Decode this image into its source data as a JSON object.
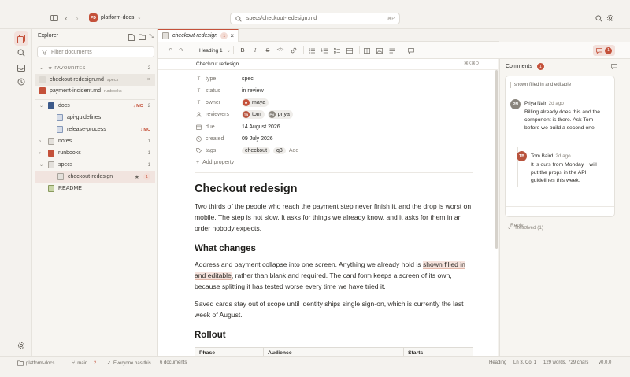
{
  "titlebar": {
    "workspace_initials": "PD",
    "workspace_name": "platform-docs",
    "search_text": "specs/checkout-redesign.md",
    "search_shortcut": "⌘P"
  },
  "sidebar": {
    "title": "Explorer",
    "filter_placeholder": "Filter documents",
    "favourites_label": "FAVOURITES",
    "favourites_count": "2",
    "favourites": [
      {
        "name": "checkout-redesign.md",
        "folder": "specs"
      },
      {
        "name": "payment-incident.md",
        "folder": "runbooks"
      }
    ],
    "tree": {
      "docs": {
        "label": "docs",
        "count": "2",
        "mc": "↓ MC"
      },
      "api_guidelines": {
        "label": "api-guidelines"
      },
      "release_process": {
        "label": "release-process",
        "mc": "↓ MC"
      },
      "notes": {
        "label": "notes",
        "count": "1"
      },
      "runbooks": {
        "label": "runbooks",
        "count": "1"
      },
      "specs": {
        "label": "specs",
        "count": "1"
      },
      "checkout_redesign": {
        "label": "checkout-redesign",
        "badge": "1"
      },
      "readme": {
        "label": "README"
      }
    }
  },
  "editor": {
    "tab_label": "checkout-redesign",
    "tab_badge": "1",
    "heading_select": "Heading 1",
    "breadcrumb": "Checkout redesign",
    "breadcrumb_shortcut": "⌘K⌘O",
    "comment_count": "1",
    "properties": {
      "type": {
        "key": "type",
        "value": "spec"
      },
      "status": {
        "key": "status",
        "value": "in review"
      },
      "owner": {
        "key": "owner",
        "value": "maya",
        "initials": "M"
      },
      "reviewers": {
        "key": "reviewers",
        "people": [
          {
            "name": "tom",
            "initials": "TB"
          },
          {
            "name": "priya",
            "initials": "PN"
          }
        ]
      },
      "due": {
        "key": "due",
        "value": "14 August 2026"
      },
      "created": {
        "key": "created",
        "value": "09 July 2026"
      },
      "tags": {
        "key": "tags",
        "items": [
          "checkout",
          "q3"
        ],
        "add_label": "Add"
      },
      "add_property": "Add property"
    },
    "title": "Checkout redesign",
    "intro": "Two thirds of the people who reach the payment step never finish it, and the drop is worst on mobile. The step is not slow. It asks for things we already know, and it asks for them in an order nobody expects.",
    "section1_heading": "What changes",
    "section1_pre": "Address and payment collapse into one screen. Anything we already hold is ",
    "section1_highlight": "shown filled in and editable",
    "section1_post": ", rather than blank and required. The card form keeps a screen of its own, because splitting it has tested worse every time we have tried it.",
    "section1_p2": "Saved cards stay out of scope until identity ships single sign-on, which is currently the last week of August.",
    "section2_heading": "Rollout",
    "table_headers": [
      "Phase",
      "Audience",
      "Starts"
    ]
  },
  "comments": {
    "title": "Comments",
    "count": "1",
    "quote": "shown filled in and editable",
    "thread": [
      {
        "initials": "PN",
        "name": "Priya Nair",
        "time": "2d ago",
        "color": "#8a857d",
        "lines": [
          "Billing already does this and the",
          "component is there. Ask Tom",
          "before we build a second one."
        ]
      },
      {
        "initials": "TB",
        "name": "Tom Baird",
        "time": "2d ago",
        "color": "#b8533d",
        "lines": [
          "It is ours from Monday. I will",
          "put the props in the API",
          "guidelines this week."
        ]
      }
    ],
    "reply_placeholder": "Reply...",
    "resolved_label": "Resolved (1)"
  },
  "statusbar": {
    "workspace": "platform-docs",
    "branch": "main",
    "behind": "↓ 2",
    "sync": "Everyone has this",
    "docs": "6 documents",
    "mode": "Heading",
    "position": "Ln 3, Col 1",
    "stats": "129 words, 729 chars",
    "version": "v0.0.0"
  },
  "colors": {
    "accent": "#c4513a",
    "background": "#f4f2ee",
    "editor": "#ffffff"
  }
}
